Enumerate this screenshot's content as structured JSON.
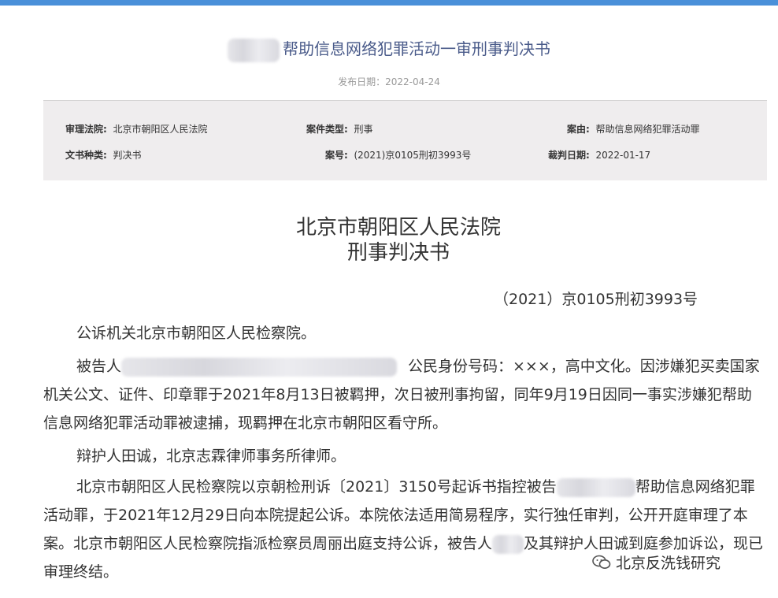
{
  "header": {
    "title": "帮助信息网络犯罪活动一审刑事判决书",
    "publish_date": "发布日期：2022-04-24"
  },
  "meta": {
    "court_label": "审理法院:",
    "court_value": "北京市朝阳区人民法院",
    "case_type_label": "案件类型:",
    "case_type_value": "刑事",
    "cause_label": "案由:",
    "cause_value": "帮助信息网络犯罪活动罪",
    "doc_type_label": "文书种类:",
    "doc_type_value": "判决书",
    "case_no_label": "案号:",
    "case_no_value": "(2021)京0105刑初3993号",
    "judgment_date_label": "裁判日期:",
    "judgment_date_value": "2022-01-17"
  },
  "document": {
    "court_name": "北京市朝阳区人民法院",
    "doc_title": "刑事判决书",
    "case_no": "（2021）京0105刑初3993号",
    "p1": "公诉机关北京市朝阳区人民检察院。",
    "p2_prefix": "被告人",
    "p2_rest": "公民身份号码：×××，高中文化。因涉嫌犯买卖国家机关公文、证件、印章罪于2021年8月13日被羁押，次日被刑事拘留，同年9月19日因同一事实涉嫌犯帮助信息网络犯罪活动罪被逮捕，现羁押在北京市朝阳区看守所。",
    "p3": "辩护人田诚，北京志霖律师事务所律师。",
    "p4_a": "北京市朝阳区人民检察院以京朝检刑诉〔2021〕3150号起诉书指控被告",
    "p4_b": "帮助信息网络犯罪活动罪，于2021年12月29日向本院提起公诉。本院依法适用简易程序，实行独任审判，公开开庭审理了本案。北京市朝阳区人民检察院指派检察员周丽出庭支持公诉，被告人",
    "p4_c": "及其辩护人田诚到庭参加诉讼，现已审理终结。"
  },
  "watermark": {
    "text": "北京反洗钱研究",
    "icon": "wechat-icon"
  }
}
